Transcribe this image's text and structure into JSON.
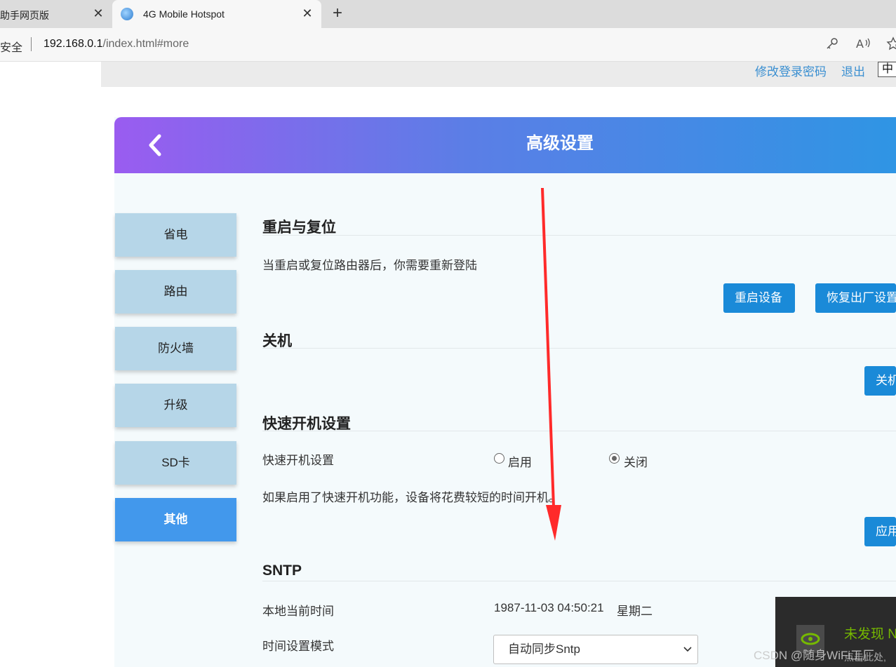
{
  "browser": {
    "tabs": [
      {
        "title": "助手网页版",
        "close": "✕"
      },
      {
        "title": "4G Mobile Hotspot",
        "close": "✕"
      }
    ],
    "new_tab": "+",
    "security_label": "安全",
    "url_host": "192.168.0.1",
    "url_path": "/index.html#more",
    "icons": [
      "key-icon",
      "read-aloud-icon",
      "favorite-star-icon"
    ]
  },
  "top_links": {
    "change_password": "修改登录密码",
    "logout": "退出",
    "language": "中文"
  },
  "panel": {
    "title": "高级设置",
    "back_icon": "chevron-left-icon"
  },
  "sidebar": {
    "items": [
      {
        "label": "省电"
      },
      {
        "label": "路由"
      },
      {
        "label": "防火墙"
      },
      {
        "label": "升级"
      },
      {
        "label": "SD卡"
      },
      {
        "label": "其他",
        "active": true
      }
    ]
  },
  "sections": {
    "reboot": {
      "title": "重启与复位",
      "description": "当重启或复位路由器后，你需要重新登陆",
      "reboot_button": "重启设备",
      "factory_reset_button": "恢复出厂设置"
    },
    "shutdown": {
      "title": "关机",
      "shutdown_button": "关机"
    },
    "fast_boot": {
      "title": "快速开机设置",
      "label": "快速开机设置",
      "option_enable": "启用",
      "option_disable": "关闭",
      "selected": "关闭",
      "note": "如果启用了快速开机功能，设备将花费较短的时间开机。",
      "apply_button": "应用"
    },
    "sntp": {
      "title": "SNTP",
      "current_time_label": "本地当前时间",
      "current_time_value": "1987-11-03 04:50:21",
      "weekday": "星期二",
      "mode_label": "时间设置模式",
      "mode_value": "自动同步Sntp"
    }
  },
  "overlay": {
    "notify_title": "未发现 N",
    "notify_sub": "点击此处,",
    "watermark": "CSDN @随身WiFi工厂"
  },
  "colors": {
    "header_gradient_start": "#9a5cf0",
    "header_gradient_end": "#2f95e4",
    "button": "#1a8ad8",
    "sidebar_item": "#b6d6e8",
    "sidebar_active": "#4298ec",
    "link": "#3a8fd1",
    "annotation_arrow": "#ff2a2a"
  }
}
